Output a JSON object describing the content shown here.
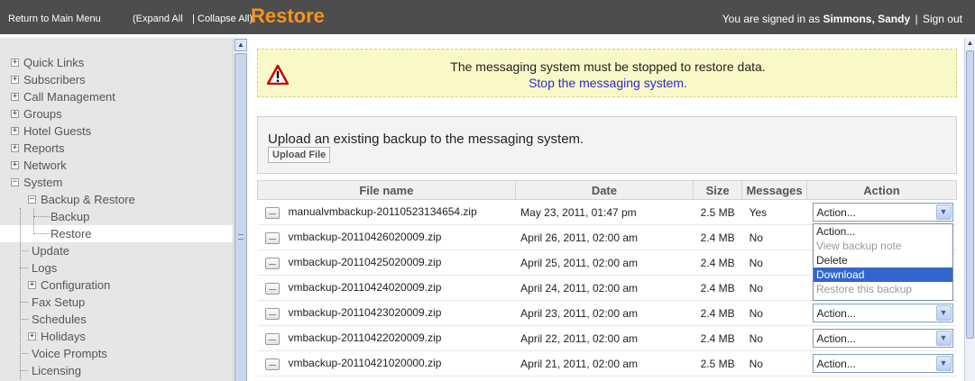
{
  "header": {
    "return_link": "Return to Main Menu",
    "expand_all": "(Expand All",
    "separator": "|",
    "collapse_all": "Collapse All)",
    "page_title": "Restore",
    "signed_in_prefix": "You are signed in as",
    "user_name": "Simmons, Sandy",
    "sign_out": "Sign out",
    "title_color": "#f7941d"
  },
  "sidebar": {
    "items": [
      {
        "label": "Quick Links",
        "expander": "+"
      },
      {
        "label": "Subscribers",
        "expander": "+"
      },
      {
        "label": "Call Management",
        "expander": "+"
      },
      {
        "label": "Groups",
        "expander": "+"
      },
      {
        "label": "Hotel Guests",
        "expander": "+"
      },
      {
        "label": "Reports",
        "expander": "+"
      },
      {
        "label": "Network",
        "expander": "+"
      },
      {
        "label": "System",
        "expander": "−"
      },
      {
        "label": "Backup & Restore",
        "expander": "−"
      },
      {
        "label": "Backup"
      },
      {
        "label": "Restore",
        "selected": true
      },
      {
        "label": "Update"
      },
      {
        "label": "Logs"
      },
      {
        "label": "Configuration",
        "expander": "+"
      },
      {
        "label": "Fax Setup"
      },
      {
        "label": "Schedules"
      },
      {
        "label": "Holidays",
        "expander": "+"
      },
      {
        "label": "Voice Prompts"
      },
      {
        "label": "Licensing"
      }
    ]
  },
  "warning": {
    "icon": "warning-triangle-icon",
    "message": "The messaging system must be stopped to restore data.",
    "link": "Stop the messaging system."
  },
  "upload": {
    "text": "Upload an existing backup to the messaging system.",
    "button": "Upload File"
  },
  "table": {
    "headers": {
      "file_name": "File name",
      "date": "Date",
      "size": "Size",
      "messages": "Messages",
      "action": "Action"
    },
    "rows": [
      {
        "file": "manualvmbackup-20110523134654.zip",
        "date": "May 23, 2011, 01:47 pm",
        "size": "2.5 MB",
        "messages": "Yes",
        "action": "Action..."
      },
      {
        "file": "vmbackup-20110426020009.zip",
        "date": "April 26, 2011, 02:00 am",
        "size": "2.4 MB",
        "messages": "No",
        "action": ""
      },
      {
        "file": "vmbackup-20110425020009.zip",
        "date": "April 25, 2011, 02:00 am",
        "size": "2.4 MB",
        "messages": "No",
        "action": ""
      },
      {
        "file": "vmbackup-20110424020009.zip",
        "date": "April 24, 2011, 02:00 am",
        "size": "2.4 MB",
        "messages": "No",
        "action": ""
      },
      {
        "file": "vmbackup-20110423020009.zip",
        "date": "April 23, 2011, 02:00 am",
        "size": "2.4 MB",
        "messages": "No",
        "action": "Action..."
      },
      {
        "file": "vmbackup-20110422020009.zip",
        "date": "April 22, 2011, 02:00 am",
        "size": "2.4 MB",
        "messages": "No",
        "action": "Action..."
      },
      {
        "file": "vmbackup-20110421020000.zip",
        "date": "April 21, 2011, 02:00 am",
        "size": "2.5 MB",
        "messages": "No",
        "action": "Action..."
      }
    ]
  },
  "dropdown": {
    "options": [
      {
        "label": "Action...",
        "state": "normal"
      },
      {
        "label": "View backup note",
        "state": "disabled"
      },
      {
        "label": "Delete",
        "state": "normal"
      },
      {
        "label": "Download",
        "state": "highlighted"
      },
      {
        "label": "Restore this backup",
        "state": "disabled"
      }
    ],
    "highlight_color": "#3366cc"
  }
}
